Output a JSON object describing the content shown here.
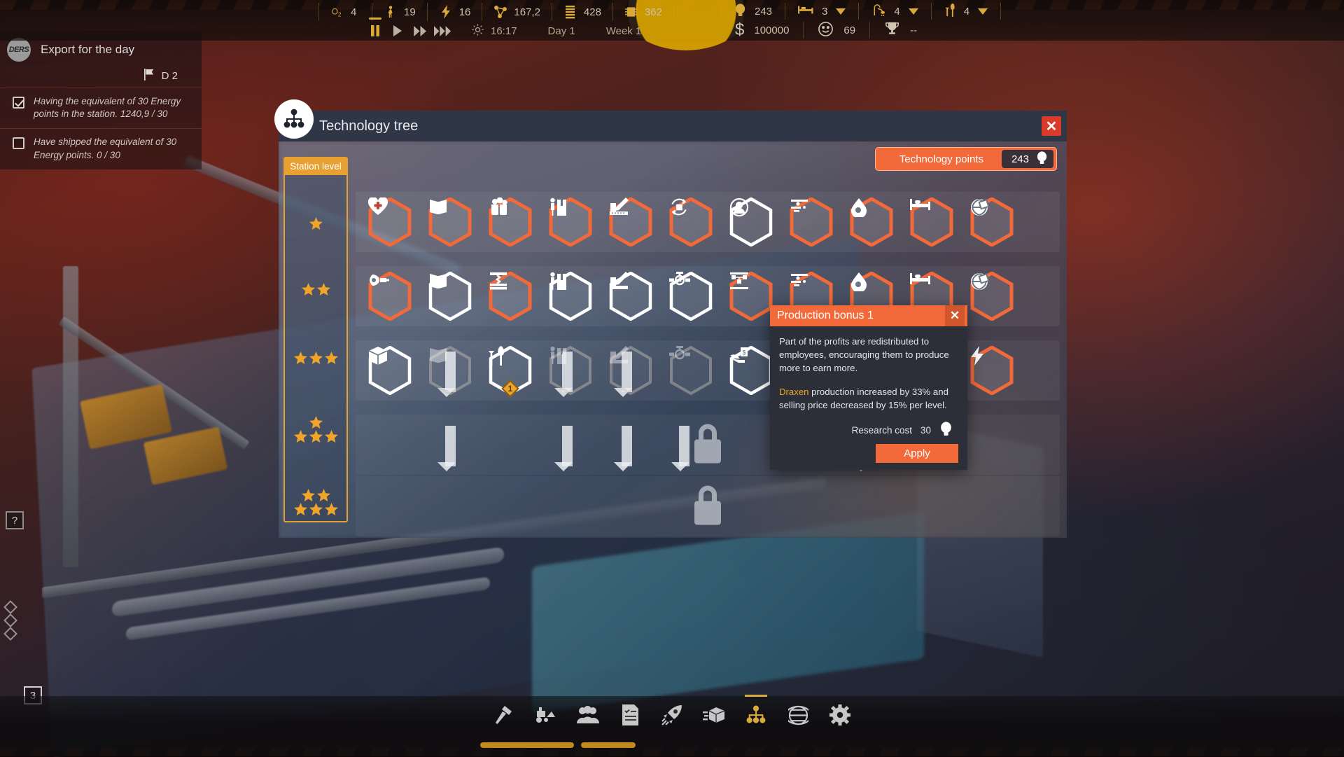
{
  "hud": {
    "resources": [
      {
        "icon": "oxygen-icon",
        "label": "O2",
        "value": "4"
      },
      {
        "icon": "worker-icon",
        "label": "Workers",
        "value": "19"
      },
      {
        "icon": "energy-icon",
        "label": "Energy",
        "value": "16"
      },
      {
        "icon": "molecule-icon",
        "label": "Research",
        "value": "167,2"
      },
      {
        "icon": "filament-icon",
        "label": "Filament",
        "value": "428"
      },
      {
        "icon": "chip-icon",
        "label": "Chip",
        "value": "362"
      }
    ],
    "right_stats": [
      {
        "icon": "lightbulb-icon",
        "label": "Technology points",
        "value": "243"
      },
      {
        "icon": "bed-icon",
        "label": "Beds",
        "value": "3",
        "caret": true
      },
      {
        "icon": "shower-icon",
        "label": "Showers",
        "value": "4",
        "caret": true
      },
      {
        "icon": "food-icon",
        "label": "Food",
        "value": "4",
        "caret": true
      }
    ],
    "time_controls": [
      {
        "icon": "pause-icon",
        "active": true
      },
      {
        "icon": "play-icon",
        "active": false
      },
      {
        "icon": "fast-forward-icon",
        "active": false
      },
      {
        "icon": "very-fast-forward-icon",
        "active": false
      }
    ],
    "clock_icon": "sun-icon",
    "clock": "16:17",
    "day": "Day 1",
    "week": "Week 1",
    "money_icon": "dollar-icon",
    "money": "100000",
    "happiness_icon": "smiley-icon",
    "happiness": "69",
    "trophy_icon": "trophy-icon",
    "trophy": "--"
  },
  "quest": {
    "logo_text": "DERS",
    "title": "Export for the day",
    "flag_icon": "flag-icon",
    "flag_label": "D 2",
    "tasks": [
      {
        "done": true,
        "text": "Having the equivalent of 30 Energy points in the station. 1240,9 / 30"
      },
      {
        "done": false,
        "text": "Have shipped the equivalent of 30 Energy points. 0 / 30"
      }
    ]
  },
  "dialog": {
    "icon": "tech-tree-icon",
    "title": "Technology tree",
    "close_icon": "close-icon",
    "points_label": "Technology points",
    "points_value": "243",
    "points_icon": "lightbulb-icon",
    "levels_header": "Station level",
    "levels": [
      {
        "stars": 1,
        "rows": [
          1
        ]
      },
      {
        "stars": 2,
        "rows": [
          2
        ]
      },
      {
        "stars": 3,
        "rows": [
          3
        ]
      },
      {
        "stars": 4,
        "rows": [
          1,
          3
        ]
      },
      {
        "stars": 5,
        "rows": [
          2,
          3
        ]
      }
    ],
    "rows": [
      {
        "level": 1,
        "locked": false,
        "nodes": [
          {
            "icon": "health-icon",
            "state": "unlocked"
          },
          {
            "icon": "book-icon",
            "state": "unlocked"
          },
          {
            "icon": "beer-icon",
            "state": "unlocked"
          },
          {
            "icon": "worker-box-icon",
            "state": "unlocked"
          },
          {
            "icon": "blueprint-icon",
            "state": "unlocked"
          },
          {
            "icon": "recycle-box-icon",
            "state": "unlocked"
          },
          {
            "icon": "profile-icon",
            "state": "available"
          },
          {
            "icon": "conveyor-icon",
            "state": "unlocked"
          },
          {
            "icon": "drop-tank-icon",
            "state": "unlocked"
          },
          {
            "icon": "bed-side-icon",
            "state": "unlocked"
          },
          {
            "icon": "globe-box-icon",
            "state": "unlocked"
          }
        ]
      },
      {
        "level": 2,
        "locked": false,
        "nodes": [
          {
            "icon": "rocket-tank-icon",
            "state": "unlocked"
          },
          {
            "icon": "book-icon",
            "state": "available"
          },
          {
            "icon": "press-icon",
            "state": "unlocked"
          },
          {
            "icon": "worker-box-icon",
            "state": "available"
          },
          {
            "icon": "blueprint-icon",
            "state": "available"
          },
          {
            "icon": "valve-icon",
            "state": "available"
          },
          {
            "icon": "lab-bench-icon",
            "state": "unlocked"
          },
          {
            "icon": "conveyor-icon",
            "state": "unlocked"
          },
          {
            "icon": "drop-tank-icon",
            "state": "unlocked"
          },
          {
            "icon": "bed-side-icon",
            "state": "unlocked"
          },
          {
            "icon": "globe-box-icon",
            "state": "unlocked"
          }
        ]
      },
      {
        "level": 3,
        "locked": false,
        "nodes": [
          {
            "icon": "box-icon",
            "state": "available"
          },
          {
            "icon": "book-icon",
            "state": "dim"
          },
          {
            "icon": "cutlery-icon",
            "state": "available",
            "badge": "1"
          },
          {
            "icon": "worker-box-icon",
            "state": "dim"
          },
          {
            "icon": "blueprint-icon",
            "state": "dim"
          },
          {
            "icon": "valve-icon",
            "state": "dim"
          },
          {
            "icon": "money-hand-icon",
            "state": "available"
          },
          {
            "icon": "conveyor-icon",
            "state": "dim"
          },
          {
            "icon": "drop-tank-icon",
            "state": "dim"
          },
          {
            "icon": "box-icon",
            "state": "unlocked"
          },
          {
            "icon": "bolt-icon",
            "state": "unlocked"
          }
        ]
      },
      {
        "level": 4,
        "locked": true,
        "lock_icon": "lock-icon",
        "nodes": []
      },
      {
        "level": 5,
        "locked": true,
        "lock_icon": "lock-icon",
        "nodes": []
      }
    ]
  },
  "tooltip": {
    "title": "Production bonus 1",
    "close_icon": "close-icon",
    "description": "Part of the profits are redistributed to employees, encouraging them to produce more to earn more.",
    "effect_resource": "Draxen",
    "effect_text": " production increased by 33% and selling price decreased by 15% per level.",
    "cost_label": "Research cost",
    "cost_value": "30",
    "cost_icon": "lightbulb-icon",
    "apply_label": "Apply"
  },
  "taskbar": [
    {
      "icon": "hammer-icon",
      "active": false
    },
    {
      "icon": "loader-icon",
      "active": false
    },
    {
      "icon": "people-icon",
      "active": false
    },
    {
      "icon": "checklist-icon",
      "active": false
    },
    {
      "icon": "rocket-icon",
      "active": false
    },
    {
      "icon": "shipping-box-icon",
      "active": false
    },
    {
      "icon": "tech-tree-icon",
      "active": true
    },
    {
      "icon": "globe-icon",
      "active": false
    },
    {
      "icon": "gear-icon",
      "active": false
    }
  ],
  "side_widgets": {
    "help_icon": "help-icon",
    "counter_badge": "3"
  },
  "colors": {
    "accent_orange": "#f2693a",
    "gold": "#d9a93c",
    "panel_blue": "#2f3645",
    "star_gold": "#f0a42a"
  }
}
